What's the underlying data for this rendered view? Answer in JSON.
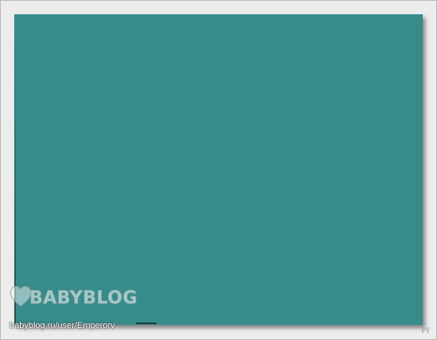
{
  "panel": {
    "color": "#388b8b"
  },
  "watermark": {
    "logo_text": "BABYBLOG",
    "url": "babyblog.ru/user/Emperorv",
    "icon": "heart-icon"
  },
  "signature": {
    "initials": "PY"
  }
}
